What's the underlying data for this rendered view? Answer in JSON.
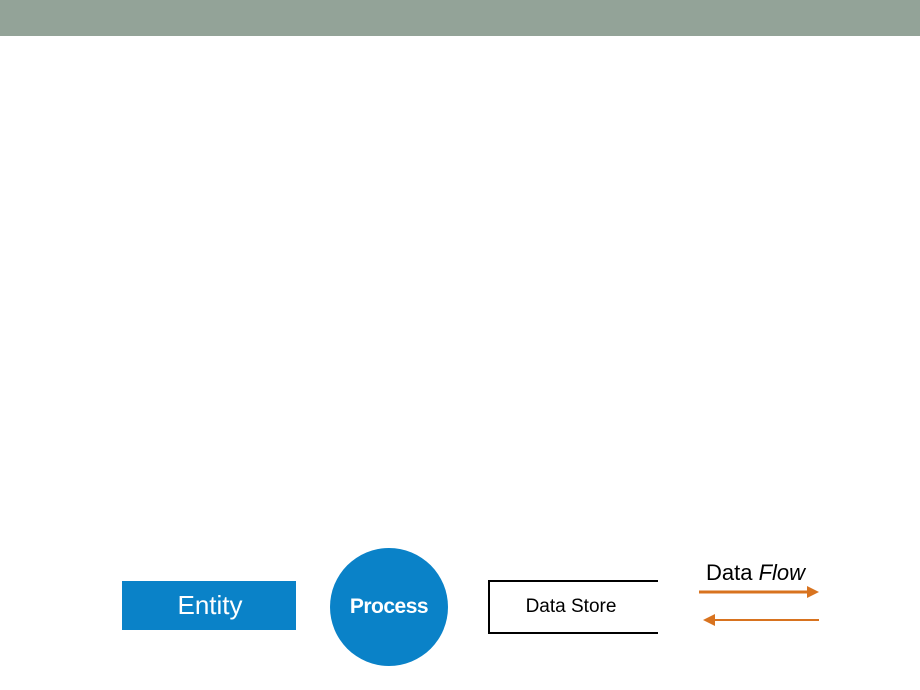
{
  "diagram": {
    "entity_label": "Entity",
    "process_label": "Process",
    "datastore_label": "Data Store",
    "dataflow": {
      "word1": "Data",
      "word2": "Flow"
    }
  },
  "colors": {
    "header_bar": "#93a398",
    "shape_fill": "#0a82c8",
    "arrow": "#d8731f"
  }
}
